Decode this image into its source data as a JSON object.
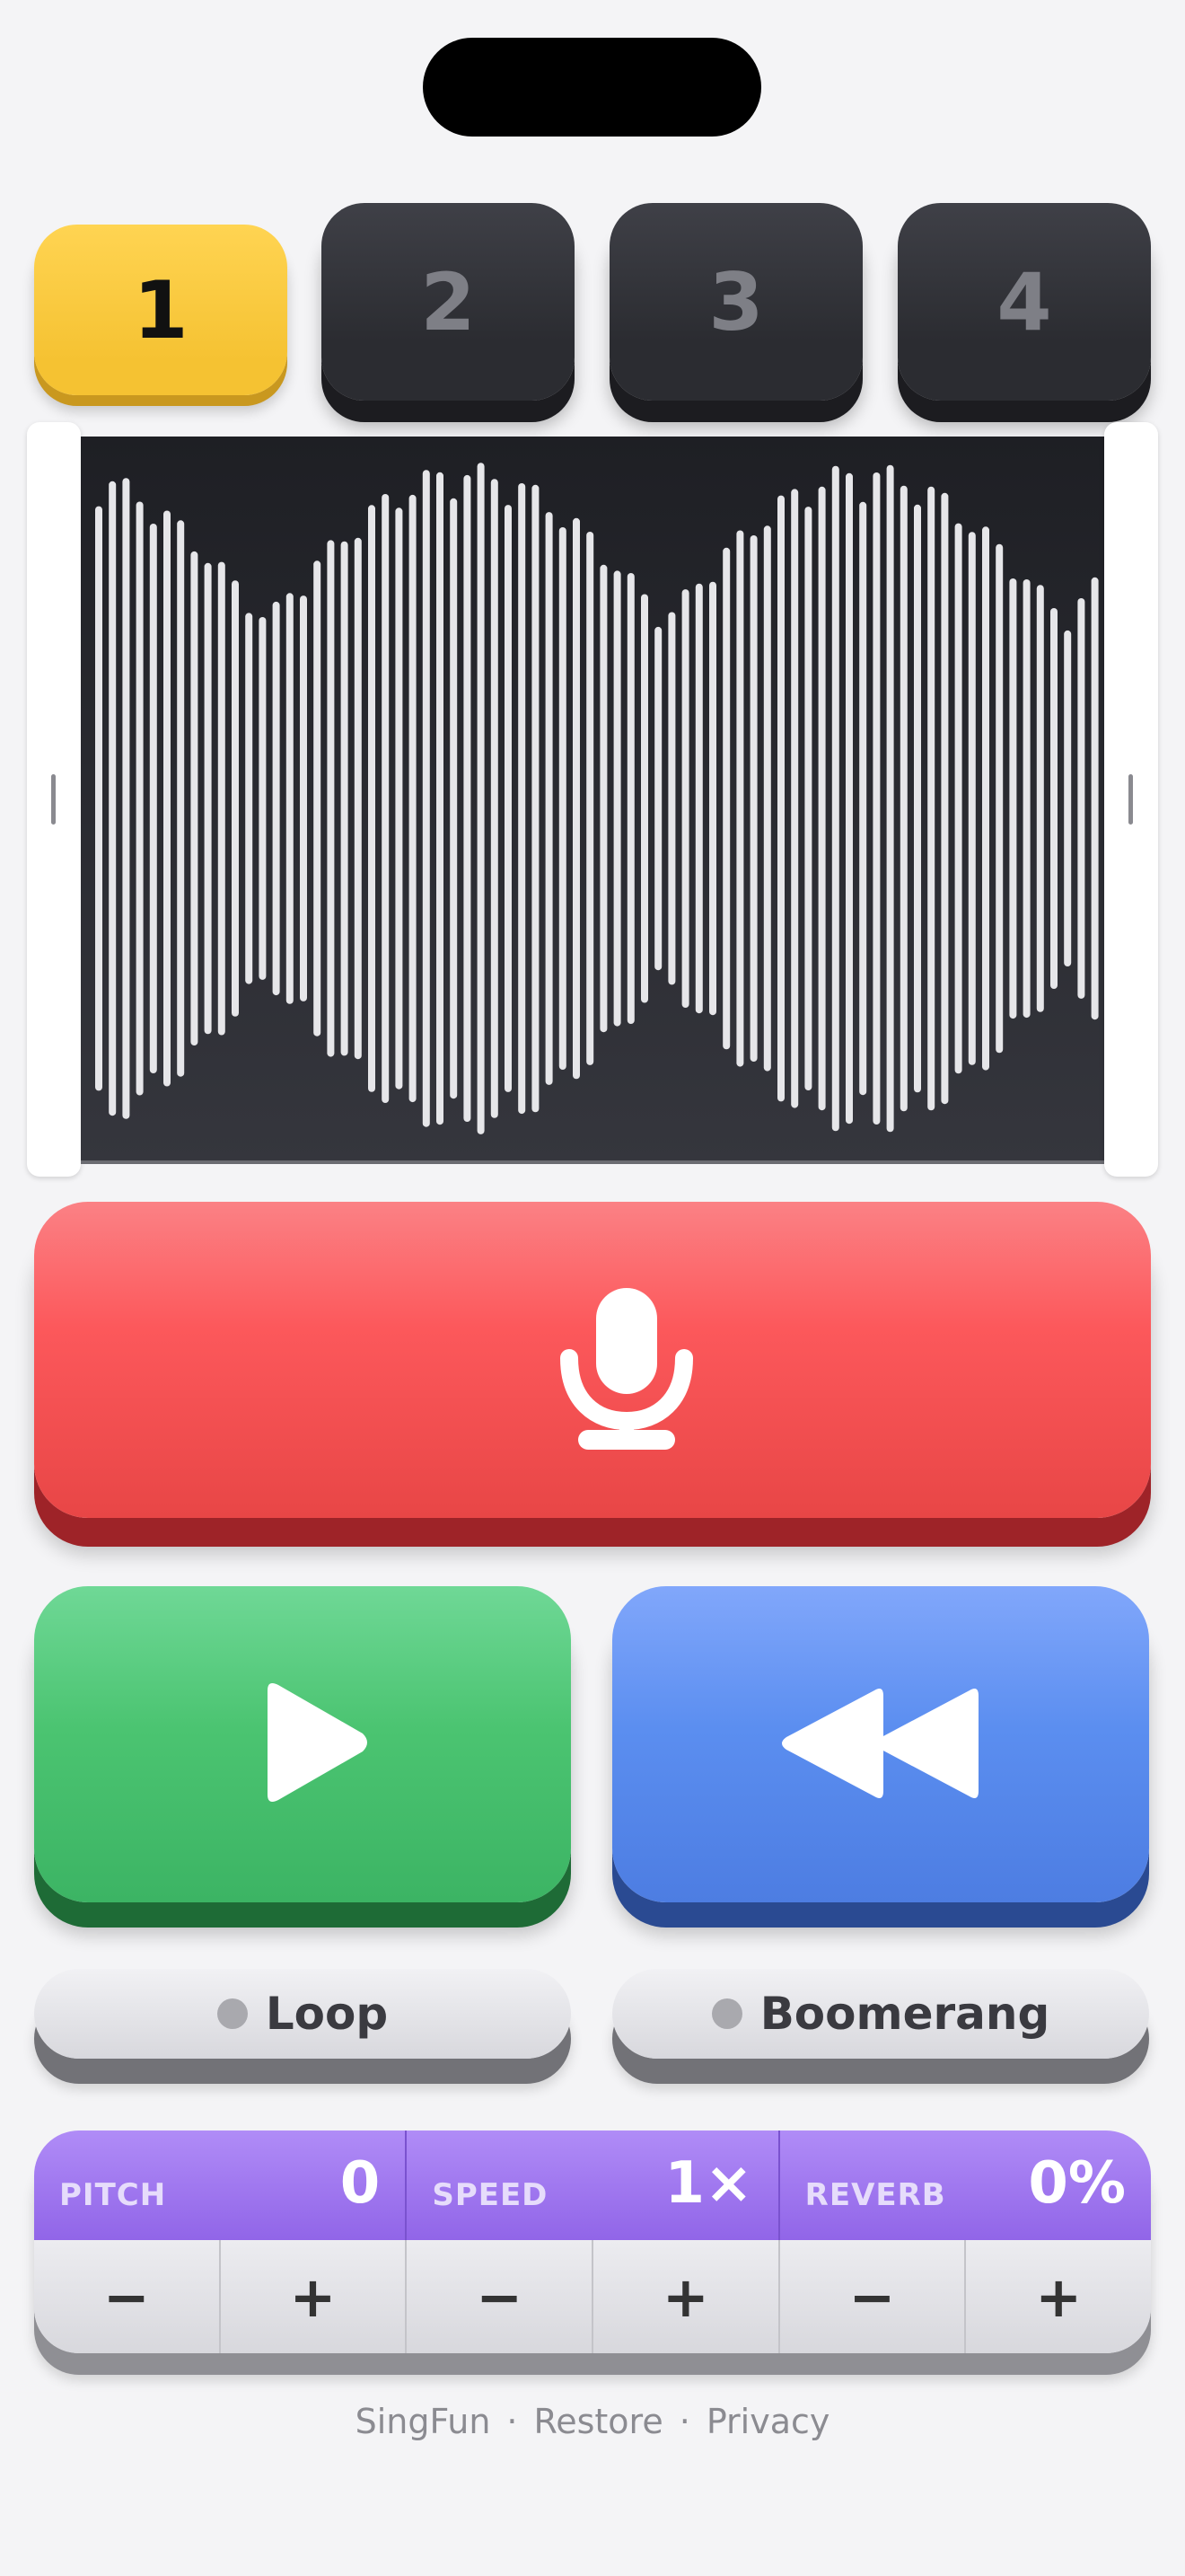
{
  "tracks": [
    "1",
    "2",
    "3",
    "4"
  ],
  "active_track": "1",
  "waveform": {
    "bar_color": "#e6e6e9",
    "background": "#26272d"
  },
  "buttons": {
    "record": {
      "icon": "microphone-icon",
      "color": "#fc585b"
    },
    "play": {
      "icon": "play-icon",
      "color": "#4bc471"
    },
    "rewind": {
      "icon": "rewind-icon",
      "color": "#5b8ef0"
    }
  },
  "toggles": {
    "loop": "Loop",
    "boomerang": "Boomerang"
  },
  "controls": [
    {
      "name": "PITCH",
      "value": "0"
    },
    {
      "name": "SPEED",
      "value": "1×"
    },
    {
      "name": "REVERB",
      "value": "0%"
    }
  ],
  "steppers": {
    "minus": "−",
    "plus": "+"
  },
  "footer": {
    "links": [
      "SingFun",
      "Restore",
      "Privacy"
    ],
    "separator": "·"
  },
  "colors": {
    "track_active": "#f5c232",
    "track_inactive": "#2f3035",
    "accent_purple": "#9165e8"
  }
}
